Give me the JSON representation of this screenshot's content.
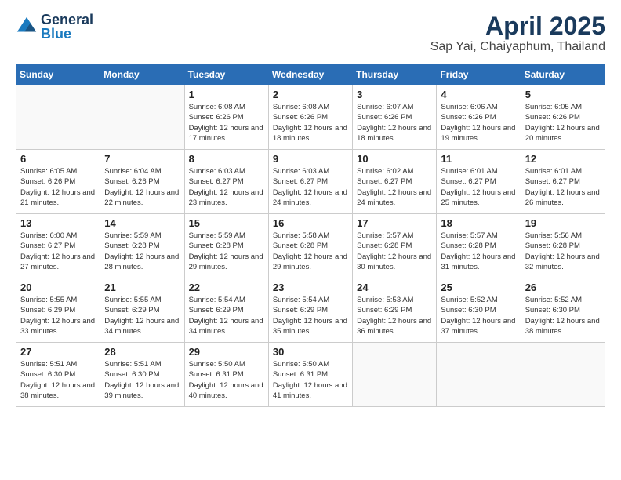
{
  "header": {
    "logo_general": "General",
    "logo_blue": "Blue",
    "title": "April 2025",
    "location": "Sap Yai, Chaiyaphum, Thailand"
  },
  "days_of_week": [
    "Sunday",
    "Monday",
    "Tuesday",
    "Wednesday",
    "Thursday",
    "Friday",
    "Saturday"
  ],
  "weeks": [
    [
      {
        "day": "",
        "info": ""
      },
      {
        "day": "",
        "info": ""
      },
      {
        "day": "1",
        "info": "Sunrise: 6:08 AM\nSunset: 6:26 PM\nDaylight: 12 hours and 17 minutes."
      },
      {
        "day": "2",
        "info": "Sunrise: 6:08 AM\nSunset: 6:26 PM\nDaylight: 12 hours and 18 minutes."
      },
      {
        "day": "3",
        "info": "Sunrise: 6:07 AM\nSunset: 6:26 PM\nDaylight: 12 hours and 18 minutes."
      },
      {
        "day": "4",
        "info": "Sunrise: 6:06 AM\nSunset: 6:26 PM\nDaylight: 12 hours and 19 minutes."
      },
      {
        "day": "5",
        "info": "Sunrise: 6:05 AM\nSunset: 6:26 PM\nDaylight: 12 hours and 20 minutes."
      }
    ],
    [
      {
        "day": "6",
        "info": "Sunrise: 6:05 AM\nSunset: 6:26 PM\nDaylight: 12 hours and 21 minutes."
      },
      {
        "day": "7",
        "info": "Sunrise: 6:04 AM\nSunset: 6:26 PM\nDaylight: 12 hours and 22 minutes."
      },
      {
        "day": "8",
        "info": "Sunrise: 6:03 AM\nSunset: 6:27 PM\nDaylight: 12 hours and 23 minutes."
      },
      {
        "day": "9",
        "info": "Sunrise: 6:03 AM\nSunset: 6:27 PM\nDaylight: 12 hours and 24 minutes."
      },
      {
        "day": "10",
        "info": "Sunrise: 6:02 AM\nSunset: 6:27 PM\nDaylight: 12 hours and 24 minutes."
      },
      {
        "day": "11",
        "info": "Sunrise: 6:01 AM\nSunset: 6:27 PM\nDaylight: 12 hours and 25 minutes."
      },
      {
        "day": "12",
        "info": "Sunrise: 6:01 AM\nSunset: 6:27 PM\nDaylight: 12 hours and 26 minutes."
      }
    ],
    [
      {
        "day": "13",
        "info": "Sunrise: 6:00 AM\nSunset: 6:27 PM\nDaylight: 12 hours and 27 minutes."
      },
      {
        "day": "14",
        "info": "Sunrise: 5:59 AM\nSunset: 6:28 PM\nDaylight: 12 hours and 28 minutes."
      },
      {
        "day": "15",
        "info": "Sunrise: 5:59 AM\nSunset: 6:28 PM\nDaylight: 12 hours and 29 minutes."
      },
      {
        "day": "16",
        "info": "Sunrise: 5:58 AM\nSunset: 6:28 PM\nDaylight: 12 hours and 29 minutes."
      },
      {
        "day": "17",
        "info": "Sunrise: 5:57 AM\nSunset: 6:28 PM\nDaylight: 12 hours and 30 minutes."
      },
      {
        "day": "18",
        "info": "Sunrise: 5:57 AM\nSunset: 6:28 PM\nDaylight: 12 hours and 31 minutes."
      },
      {
        "day": "19",
        "info": "Sunrise: 5:56 AM\nSunset: 6:28 PM\nDaylight: 12 hours and 32 minutes."
      }
    ],
    [
      {
        "day": "20",
        "info": "Sunrise: 5:55 AM\nSunset: 6:29 PM\nDaylight: 12 hours and 33 minutes."
      },
      {
        "day": "21",
        "info": "Sunrise: 5:55 AM\nSunset: 6:29 PM\nDaylight: 12 hours and 34 minutes."
      },
      {
        "day": "22",
        "info": "Sunrise: 5:54 AM\nSunset: 6:29 PM\nDaylight: 12 hours and 34 minutes."
      },
      {
        "day": "23",
        "info": "Sunrise: 5:54 AM\nSunset: 6:29 PM\nDaylight: 12 hours and 35 minutes."
      },
      {
        "day": "24",
        "info": "Sunrise: 5:53 AM\nSunset: 6:29 PM\nDaylight: 12 hours and 36 minutes."
      },
      {
        "day": "25",
        "info": "Sunrise: 5:52 AM\nSunset: 6:30 PM\nDaylight: 12 hours and 37 minutes."
      },
      {
        "day": "26",
        "info": "Sunrise: 5:52 AM\nSunset: 6:30 PM\nDaylight: 12 hours and 38 minutes."
      }
    ],
    [
      {
        "day": "27",
        "info": "Sunrise: 5:51 AM\nSunset: 6:30 PM\nDaylight: 12 hours and 38 minutes."
      },
      {
        "day": "28",
        "info": "Sunrise: 5:51 AM\nSunset: 6:30 PM\nDaylight: 12 hours and 39 minutes."
      },
      {
        "day": "29",
        "info": "Sunrise: 5:50 AM\nSunset: 6:31 PM\nDaylight: 12 hours and 40 minutes."
      },
      {
        "day": "30",
        "info": "Sunrise: 5:50 AM\nSunset: 6:31 PM\nDaylight: 12 hours and 41 minutes."
      },
      {
        "day": "",
        "info": ""
      },
      {
        "day": "",
        "info": ""
      },
      {
        "day": "",
        "info": ""
      }
    ]
  ]
}
